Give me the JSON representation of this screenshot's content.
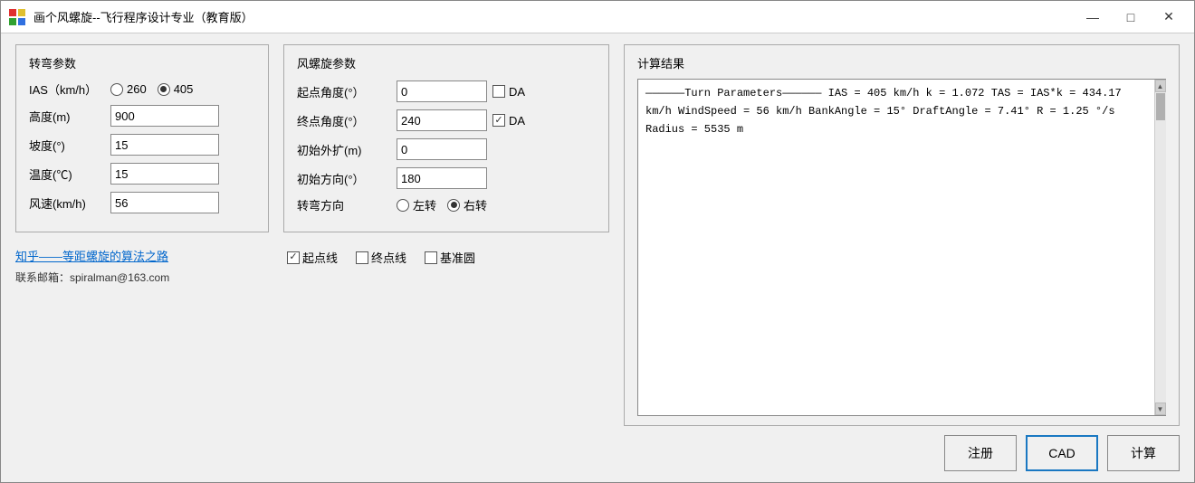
{
  "window": {
    "title": "画个风螺旋--飞行程序设计专业（教育版）",
    "icon_color_red": "#e03030",
    "icon_color_yellow": "#e0c030"
  },
  "titlebar": {
    "minimize_label": "—",
    "maximize_label": "□",
    "close_label": "✕"
  },
  "turn_params": {
    "section_title": "转弯参数",
    "ias_label": "IAS（km/h）",
    "ias_option1": "260",
    "ias_option2": "405",
    "ias_option2_selected": true,
    "altitude_label": "高度(m)",
    "altitude_value": "900",
    "bank_label": "坡度(°)",
    "bank_value": "15",
    "temp_label": "温度(℃)",
    "temp_value": "15",
    "wind_label": "风速(km/h)",
    "wind_value": "56"
  },
  "spiral_params": {
    "section_title": "风螺旋参数",
    "start_angle_label": "起点角度(°）",
    "start_angle_value": "0",
    "start_da_checked": false,
    "da_label": "DA",
    "end_angle_label": "终点角度(°）",
    "end_angle_value": "240",
    "end_da_checked": true,
    "initial_expand_label": "初始外扩(m)",
    "initial_expand_value": "0",
    "initial_dir_label": "初始方向(°）",
    "initial_dir_value": "180",
    "turn_dir_label": "转弯方向",
    "turn_left": "左转",
    "turn_right": "右转",
    "turn_right_selected": true,
    "start_line_label": "起点线",
    "start_line_checked": true,
    "end_line_label": "终点线",
    "end_line_checked": false,
    "base_circle_label": "基准圆",
    "base_circle_checked": false
  },
  "results": {
    "section_title": "计算结果",
    "lines": [
      "——————Turn Parameters——————",
      "IAS = 405 km/h",
      "k = 1.072",
      "TAS = IAS*k = 434.17 km/h",
      "WindSpeed = 56 km/h",
      "BankAngle = 15°",
      "DraftAngle = 7.41°",
      "R = 1.25 °/s",
      "Radius = 5535 m"
    ]
  },
  "link": {
    "text": "知乎——等距螺旋的算法之路"
  },
  "email": {
    "label": "联系邮箱：spiralman@163.com"
  },
  "buttons": {
    "register": "注册",
    "cad": "CAD",
    "calculate": "计算"
  }
}
